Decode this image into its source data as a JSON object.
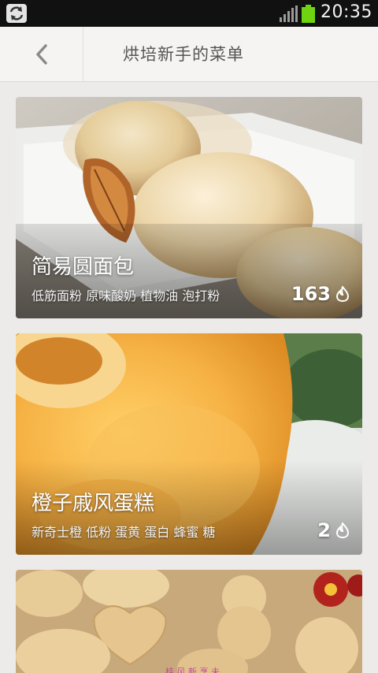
{
  "status_bar": {
    "time": "20:35",
    "icons": [
      "sync-icon",
      "signal-icon",
      "battery-icon"
    ],
    "battery_color": "#6fd40f"
  },
  "header": {
    "title": "烘培新手的菜单",
    "back_icon": "chevron-left-icon"
  },
  "recipes": [
    {
      "title": "简易圆面包",
      "ingredients": "低筋面粉 原味酸奶 植物油 泡打粉",
      "count": "163",
      "count_icon": "flame-icon"
    },
    {
      "title": "橙子戚风蛋糕",
      "ingredients": "新奇士橙 低粉 蛋黄 蛋白 蜂蜜 糖",
      "count": "2",
      "count_icon": "flame-icon"
    },
    {
      "watermark": "桂 风 新 烹 未"
    }
  ],
  "colors": {
    "background": "#ecebea",
    "header_bg": "#f5f4f3",
    "title_text": "#555555"
  }
}
